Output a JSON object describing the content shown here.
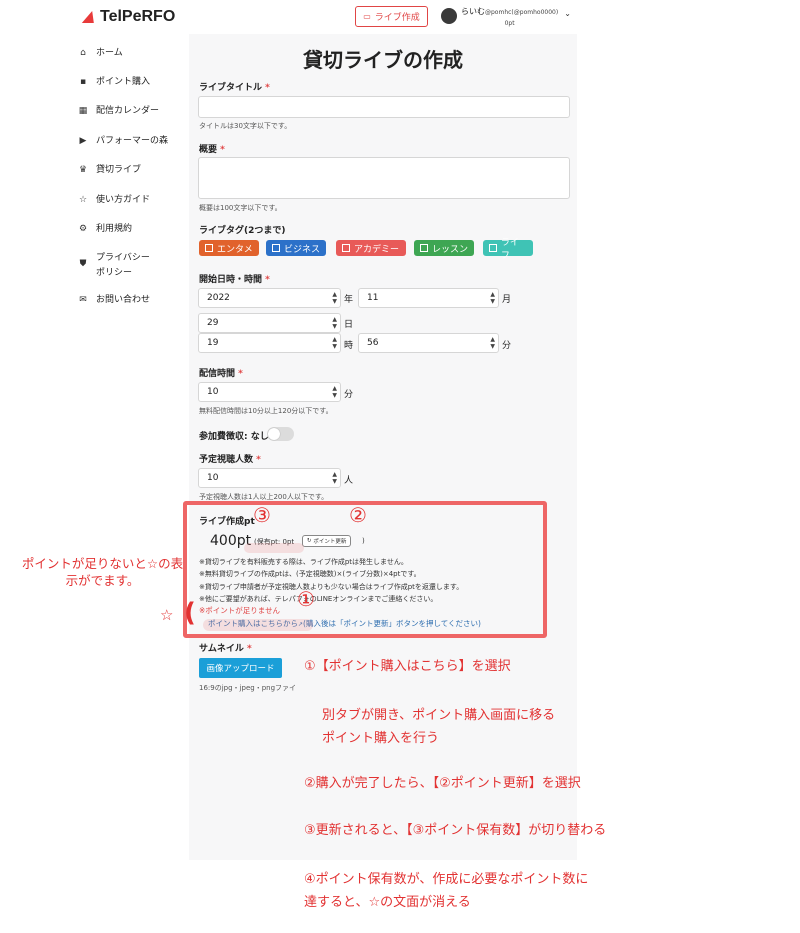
{
  "brand": {
    "name": "TelPeRFO"
  },
  "sidebar": {
    "items": [
      {
        "label": "ホーム",
        "icon": "home-icon",
        "glyph": "⌂"
      },
      {
        "label": "ポイント購入",
        "icon": "point-icon",
        "glyph": "▪"
      },
      {
        "label": "配信カレンダー",
        "icon": "calendar-icon",
        "glyph": "▦"
      },
      {
        "label": "パフォーマーの森",
        "icon": "performer-icon",
        "glyph": "▶"
      },
      {
        "label": "貸切ライブ",
        "icon": "crown-icon",
        "glyph": "♛"
      },
      {
        "label": "使い方ガイド",
        "icon": "star-icon",
        "glyph": "☆"
      },
      {
        "label": "利用規約",
        "icon": "gear-icon",
        "glyph": "⚙"
      },
      {
        "label": "プライバシーポリシー",
        "icon": "shield-icon",
        "glyph": "⛊"
      },
      {
        "label": "お問い合わせ",
        "icon": "mail-icon",
        "glyph": "✉"
      }
    ]
  },
  "header": {
    "live_button": "ライブ作成",
    "user_name": "らいむ",
    "user_handle": "@pomhc(@pomho0000)",
    "user_points": "0pt"
  },
  "form": {
    "page_title": "貸切ライブの作成",
    "title_label": "ライブタイトル",
    "title_hint": "タイトルは30文字以下です。",
    "summary_label": "概要",
    "summary_hint": "概要は100文字以下です。",
    "tags_label": "ライブタグ(2つまで)",
    "tags": [
      {
        "label": "エンタメ",
        "color": "#e1622c"
      },
      {
        "label": "ビジネス",
        "color": "#2c71c9"
      },
      {
        "label": "アカデミー",
        "color": "#e85a58"
      },
      {
        "label": "レッスン",
        "color": "#3ea653"
      },
      {
        "label": "ライフ",
        "color": "#3fc3b5"
      }
    ],
    "datetime_label": "開始日時・時間",
    "year": "2022",
    "year_unit": "年",
    "month": "11",
    "month_unit": "月",
    "day": "29",
    "day_unit": "日",
    "hour": "19",
    "hour_unit": "時",
    "minute": "56",
    "minute_unit": "分",
    "duration_label": "配信時間",
    "duration": "10",
    "duration_unit": "分",
    "duration_hint": "無料配信時間は10分以上120分以下です。",
    "fee_label": "参加費徴収: なし",
    "viewers_label": "予定視聴人数",
    "viewers": "10",
    "viewers_unit": "人",
    "viewers_hint": "予定視聴人数は1人以上200人以下です。",
    "pt_label": "ライブ作成pt",
    "pt_amount": "400pt",
    "pt_owned": "(保有pt: 0pt",
    "pt_update": "ポイント更新",
    "pt_close": ")",
    "notes": [
      "※貸切ライブを有料販売する際は、ライブ作成ptは発生しません。",
      "※無料貸切ライブの作成ptは、(予定視聴数)×(ライブ分数)×4ptです。",
      "※貸切ライブ申請者が予定視聴人数よりも少ない場合はライブ作成ptを返還します。",
      "※他にご要望があれば、テレパフォのLINEオンラインまでご連絡ください。"
    ],
    "pt_warning": "※ポイントが足りません",
    "pt_link": "ポイント購入はこちらから",
    "pt_link_note": "(購入後は「ポイント更新」ボタンを押してください)",
    "thumb_label": "サムネイル",
    "upload_button": "画像アップロード",
    "thumb_hint": "16:9のjpg・jpeg・pngファイ"
  },
  "annotations": {
    "side": "ポイントが足りないと☆の表示がでます。",
    "star": "☆",
    "paren": "(",
    "num1": "①",
    "num2": "②",
    "num3": "③",
    "step1": "①【ポイント購入はこちら】を選択",
    "step1_sub1": "別タブが開き、ポイント購入画面に移る",
    "step1_sub2": "ポイント購入を行う",
    "step2": "②購入が完了したら、【②ポイント更新】を選択",
    "step3": "③更新されると、【③ポイント保有数】が切り替わる",
    "step4_line1": "④ポイント保有数が、作成に必要なポイント数に",
    "step4_line2": "達すると、☆の文面が消える"
  },
  "colors": {
    "accent": "#e04545",
    "link": "#2f6fb0",
    "upload": "#1b9fd8",
    "annotation": "#e23232"
  }
}
